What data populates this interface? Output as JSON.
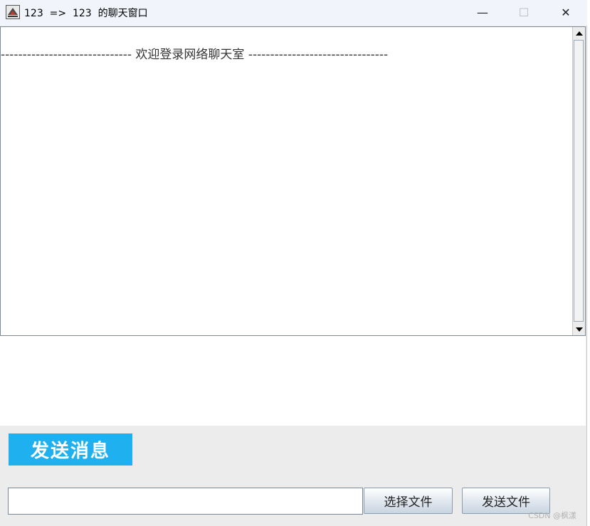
{
  "window": {
    "title": "123  =>  123  的聊天窗口",
    "minimize_symbol": "—",
    "maximize_symbol": "☐",
    "close_symbol": "✕"
  },
  "chat": {
    "welcome_line": "------------------------------  欢迎登录网络聊天室  --------------------------------"
  },
  "send_message": {
    "label": "发送消息"
  },
  "file": {
    "input_value": "",
    "choose_button": "选择文件",
    "send_button": "发送文件"
  },
  "watermark": "CSDN @枫漾",
  "icons": {
    "app": "java-cup-icon",
    "scroll_up": "arrow-up-icon",
    "scroll_down": "arrow-down-icon"
  },
  "colors": {
    "send_banner": "#1fb0ef",
    "title_bar": "#f1f5fb"
  }
}
